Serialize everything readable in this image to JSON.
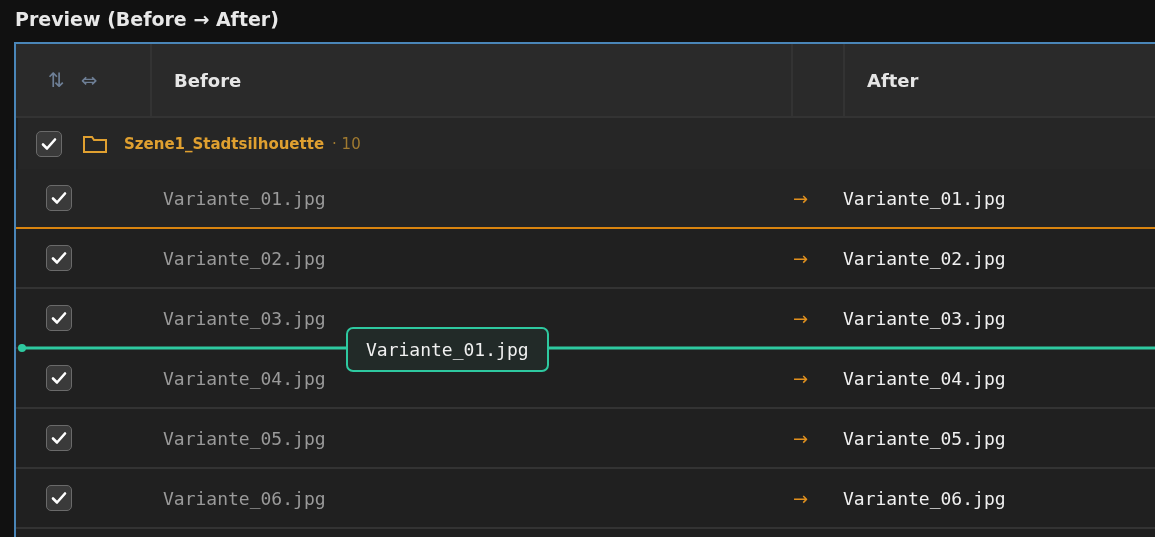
{
  "title": "Preview (Before → After)",
  "header": {
    "sort_glyph": "⇅",
    "swap_glyph": "⇔",
    "columns": [
      "Before",
      "After"
    ]
  },
  "group": {
    "name": "Szene1_Stadtsilhouette",
    "count": "· 10",
    "checked": true
  },
  "rows": [
    {
      "checked": true,
      "before": "Variante_01.jpg",
      "arrow": "→",
      "after": "Variante_01.jpg",
      "selected": true,
      "drop_indicator": false
    },
    {
      "checked": true,
      "before": "Variante_02.jpg",
      "arrow": "→",
      "after": "Variante_02.jpg",
      "selected": false,
      "drop_indicator": false
    },
    {
      "checked": true,
      "before": "Variante_03.jpg",
      "arrow": "→",
      "after": "Variante_03.jpg",
      "selected": false,
      "drop_indicator": true
    },
    {
      "checked": true,
      "before": "Variante_04.jpg",
      "arrow": "→",
      "after": "Variante_04.jpg",
      "selected": false,
      "drop_indicator": false
    },
    {
      "checked": true,
      "before": "Variante_05.jpg",
      "arrow": "→",
      "after": "Variante_05.jpg",
      "selected": false,
      "drop_indicator": false
    },
    {
      "checked": true,
      "before": "Variante_06.jpg",
      "arrow": "→",
      "after": "Variante_06.jpg",
      "selected": false,
      "drop_indicator": false
    }
  ],
  "drag_label": "Variante_01.jpg"
}
